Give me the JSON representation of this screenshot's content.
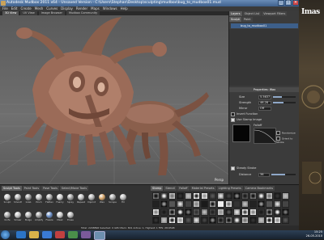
{
  "window": {
    "title": "Autodesk Mudbox 2011 x64 - Unsaved Version - C:\\Users\\Stephan\\Desktop\\sculpting\\mudbox\\bug_to_mudbox01.mud"
  },
  "menubar": [
    "File",
    "Edit",
    "Create",
    "Mesh",
    "Curves",
    "Display",
    "Render",
    "Maps",
    "Windows",
    "Help"
  ],
  "viewport_tabs": [
    "3D View",
    "UV View",
    "Image Browser",
    "Mudbox Community"
  ],
  "viewport": {
    "camera_label": "Persp"
  },
  "right_panel": {
    "tabs": [
      "Layers",
      "Object List",
      "Viewport Filters"
    ],
    "subtabs": [
      "Sculpt",
      "Paint"
    ],
    "layer_name": "bug_to_mudbox01",
    "properties_title": "Properties: Wax",
    "props": [
      {
        "label": "Size",
        "value": "5.5637",
        "fill": 0.4
      },
      {
        "label": "Strength",
        "value": "46.28",
        "fill": 0.46
      },
      {
        "label": "Mirror",
        "value": "Off"
      }
    ],
    "invert_label": "Invert Function",
    "use_stamp_label": "Use Stamp Image",
    "falloff_label": "Falloff",
    "steady_stroke_label": "Steady Stroke",
    "distance_label": "Distance",
    "distance_value": "36",
    "randomize_label": "Randomize",
    "orient_label": "Orient to Stroke",
    "stamp_spacing_label": "Stamp Spacing"
  },
  "tray": {
    "left_tabs": [
      "Sculpt Tools",
      "Paint Tools",
      "Pose Tools",
      "Select/Move Tools"
    ],
    "right_tabs": [
      "Stamp",
      "Stencil",
      "Falloff",
      "Material Presets",
      "Lighting Presets",
      "Camera Bookmarks"
    ],
    "tools_row1": [
      {
        "name": "Sculpt",
        "color": "#c8c8c8"
      },
      {
        "name": "Smooth",
        "color": "#b0b0b0"
      },
      {
        "name": "Grab",
        "color": "#9a9a9a"
      },
      {
        "name": "Pinch",
        "color": "#bcbcbc"
      },
      {
        "name": "Flatten",
        "color": "#a6a6a6"
      },
      {
        "name": "Foamy",
        "color": "#d0d0d0"
      },
      {
        "name": "Spray",
        "color": "#a0a0a0"
      },
      {
        "name": "Repeat",
        "color": "#c0c0c0"
      },
      {
        "name": "Imprint",
        "color": "#b4b4b4"
      },
      {
        "name": "Wax",
        "color": "#d6a56a"
      },
      {
        "name": "Scrape",
        "color": "#aaaaaa"
      },
      {
        "name": "Fill",
        "color": "#bababa"
      }
    ],
    "tools_row2": [
      {
        "name": "Knife",
        "color": "#a8a8a8"
      },
      {
        "name": "Smear",
        "color": "#c4c4c4"
      },
      {
        "name": "Bulge",
        "color": "#b2b2b2"
      },
      {
        "name": "Amplify",
        "color": "#9e9e9e"
      },
      {
        "name": "Freeze",
        "color": "#6b8fc7"
      },
      {
        "name": "Mask",
        "color": "#c9c9c9"
      },
      {
        "name": "Erase",
        "color": "#b8b8b8"
      }
    ],
    "status_text": "Total: 2298896   Selected: 0   GPU Mem: 801   Active: 1, Highest: 1   FPS: 28.6598"
  },
  "book": {
    "title": "Imas"
  },
  "taskbar": {
    "time": "15:25",
    "date": "26-05-2010"
  }
}
